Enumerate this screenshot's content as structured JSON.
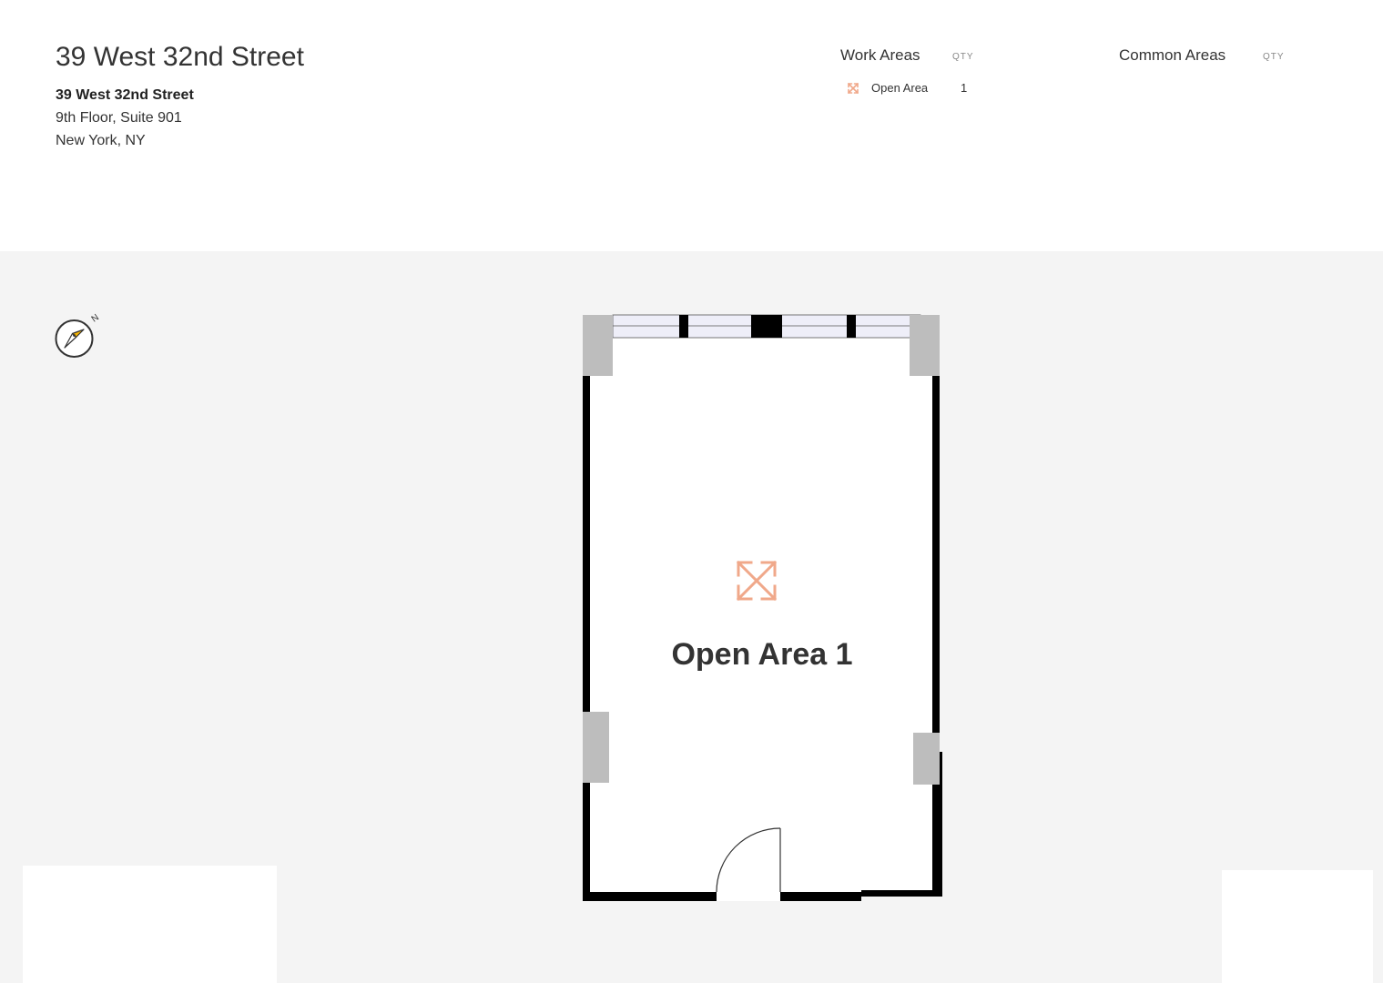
{
  "header": {
    "title": "39 West 32nd Street",
    "address": {
      "name": "39 West 32nd Street",
      "line1": "9th Floor, Suite 901",
      "line2": "New York, NY"
    }
  },
  "legend": {
    "work_areas": {
      "heading": "Work Areas",
      "qty_label": "QTY",
      "items": [
        {
          "icon": "open-area-icon",
          "label": "Open Area",
          "qty": "1"
        }
      ]
    },
    "common_areas": {
      "heading": "Common Areas",
      "qty_label": "QTY",
      "items": []
    }
  },
  "floorplan": {
    "compass": {
      "icon": "compass-icon",
      "north_label": "N"
    },
    "rooms": [
      {
        "label": "Open Area 1",
        "type": "Open Area",
        "icon": "open-area-icon"
      }
    ]
  },
  "colors": {
    "page_bg": "#ffffff",
    "plan_bg": "#f4f4f4",
    "wall": "#000000",
    "column": "#bdbdbd",
    "window_glass": "#eeeef8",
    "open_area_accent": "#f0a88a",
    "compass_needle": "#f5b400"
  }
}
